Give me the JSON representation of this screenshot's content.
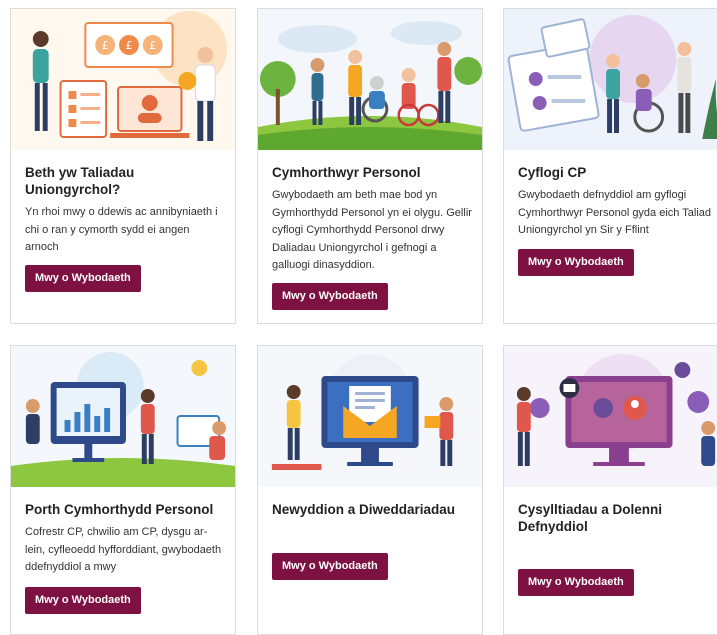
{
  "cards": [
    {
      "title": "Beth yw Taliadau Uniongyrchol?",
      "description": "Yn rhoi mwy o ddewis ac annibyniaeth i chi o ran y cymorth sydd ei angen arnoch",
      "button": "Mwy o Wybodaeth",
      "illustration": "money-illustration"
    },
    {
      "title": "Cymhorthwyr Personol",
      "description": "Gwybodaeth am beth mae bod yn Gymhorthydd Personol yn ei olygu. Gellir cyflogi Cymhorthydd Personol drwy Daliadau Uniongyrchol i gefnogi a galluogi dinasyddion.",
      "button": "Mwy o Wybodaeth",
      "illustration": "people-park-illustration"
    },
    {
      "title": "Cyflogi CP",
      "description": "Gwybodaeth defnyddiol am gyflogi Cymhorthwyr Personol gyda eich Taliad Uniongyrchol yn Sir y Fflint",
      "button": "Mwy o Wybodaeth",
      "illustration": "employ-illustration"
    },
    {
      "title": "Porth Cymhorthydd Personol",
      "description": "Cofrestr CP, chwilio am CP, dysgu ar-lein, cyfleoedd hyfforddiant, gwybodaeth ddefnyddiol a mwy",
      "button": "Mwy o Wybodaeth",
      "illustration": "portal-illustration"
    },
    {
      "title": "Newyddion a Diweddariadau",
      "description": "",
      "button": "Mwy o Wybodaeth",
      "illustration": "news-illustration"
    },
    {
      "title": "Cysylltiadau a Dolenni Defnyddiol",
      "description": "",
      "button": "Mwy o Wybodaeth",
      "illustration": "links-illustration"
    }
  ],
  "colors": {
    "button": "#7d1142",
    "border": "#dcdcdc"
  }
}
